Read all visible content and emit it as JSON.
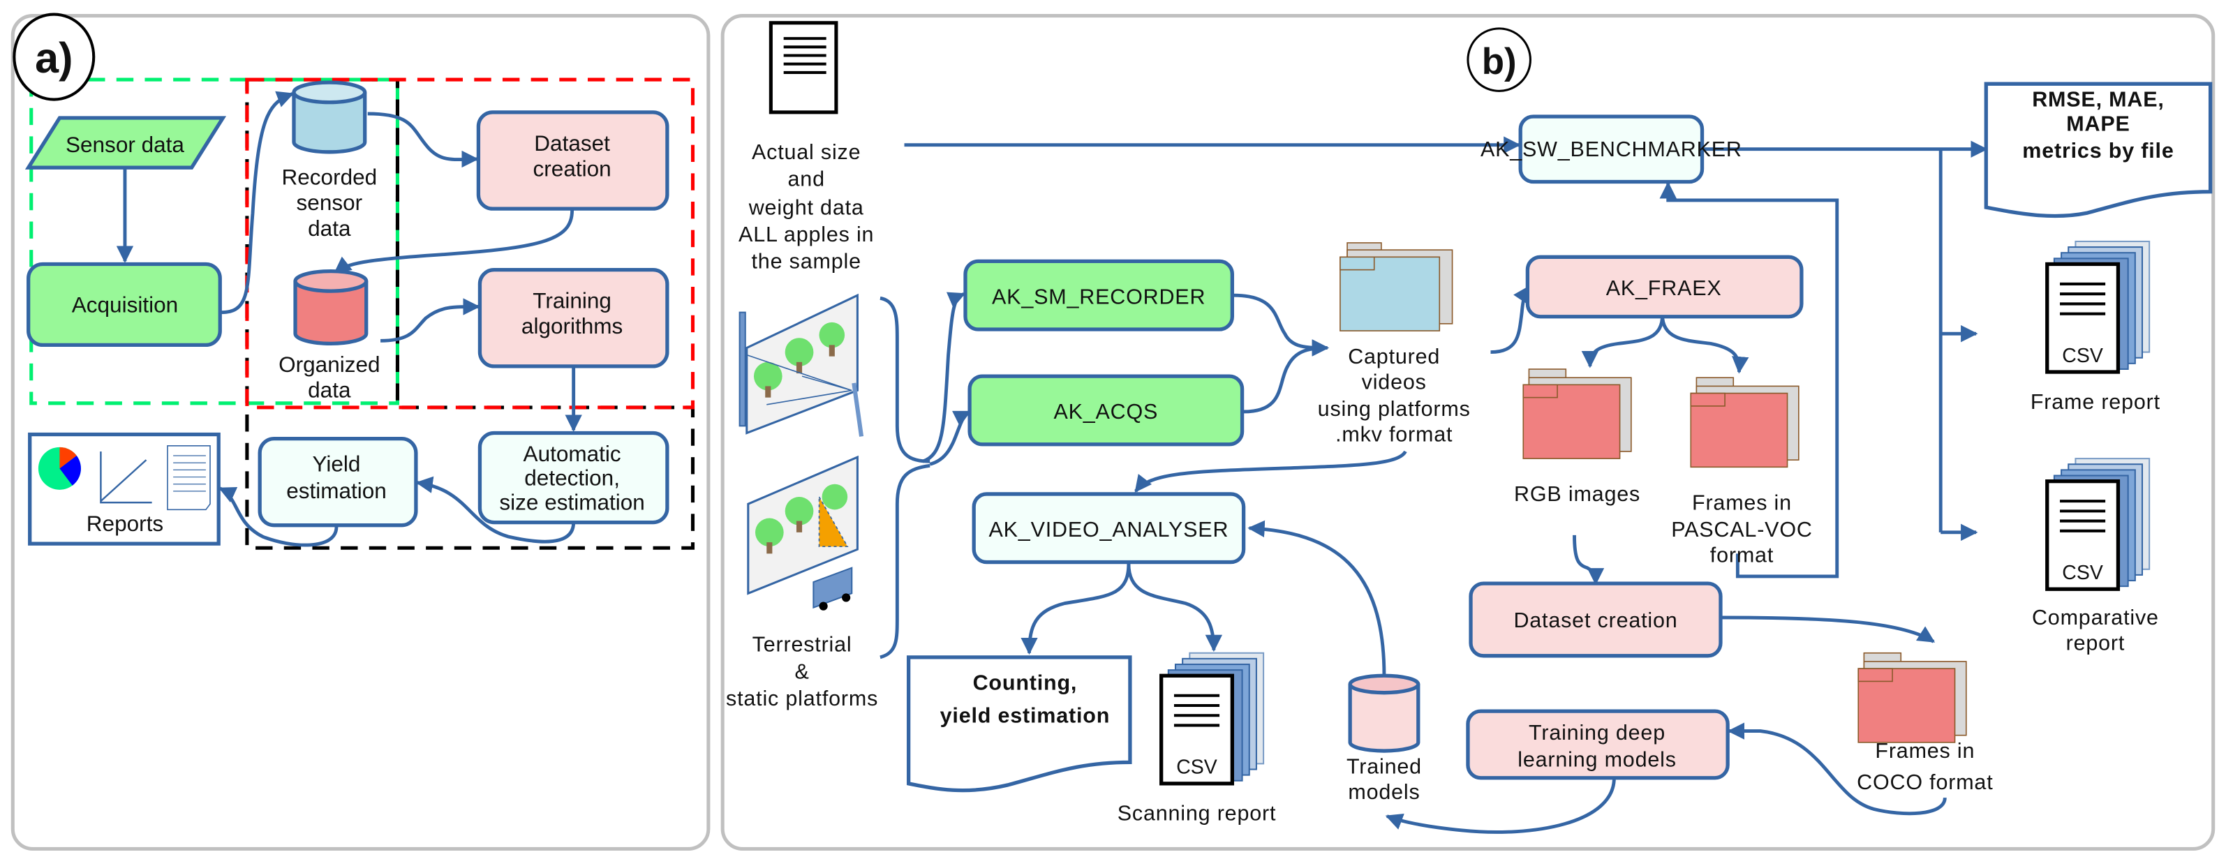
{
  "panel_a": {
    "label": "a)",
    "sensor_data": "Sensor data",
    "acquisition": "Acquisition",
    "recorded": [
      "Recorded",
      "sensor",
      "data"
    ],
    "organized": [
      "Organized",
      "data"
    ],
    "dataset_creation": [
      "Dataset",
      "creation"
    ],
    "training": [
      "Training",
      "algorithms"
    ],
    "automatic": [
      "Automatic",
      "detection,",
      "size estimation"
    ],
    "yield": [
      "Yield",
      "estimation"
    ],
    "reports": "Reports"
  },
  "panel_b": {
    "label": "b)",
    "actual_data": [
      "Actual size",
      "and",
      "weight data",
      "ALL apples in",
      "the sample"
    ],
    "platforms": [
      "Terrestrial",
      "&",
      "static platforms"
    ],
    "sm_recorder": "AK_SM_RECORDER",
    "acqs": "AK_ACQS",
    "captured": [
      "Captured",
      "videos",
      "using platforms",
      ".mkv format"
    ],
    "video_analyser": "AK_VIDEO_ANALYSER",
    "counting": [
      "Counting,",
      "yield estimation"
    ],
    "csv": "CSV",
    "scanning_report": "Scanning report",
    "trained_models": [
      "Trained",
      "models"
    ],
    "benchmarker": "AK_SW_BENCHMARKER",
    "metrics": [
      "RMSE, MAE,",
      "MAPE",
      "metrics by file"
    ],
    "frame_report": "Frame report",
    "comparative_report": [
      "Comparative",
      "report"
    ],
    "fraex": "AK_FRAEX",
    "rgb_images": "RGB images",
    "pascal": [
      "Frames in",
      "PASCAL-VOC",
      "format"
    ],
    "dataset_creation": "Dataset creation",
    "coco": [
      "Frames in",
      "COCO format"
    ],
    "training_deep": [
      "Training deep",
      "learning models"
    ]
  },
  "colors": {
    "stroke": "#3465a4",
    "green": "#98f898",
    "pink": "#fadcdc",
    "light": "#f3fffb",
    "blue_data": "#add8e6",
    "red_data": "#f08080"
  }
}
